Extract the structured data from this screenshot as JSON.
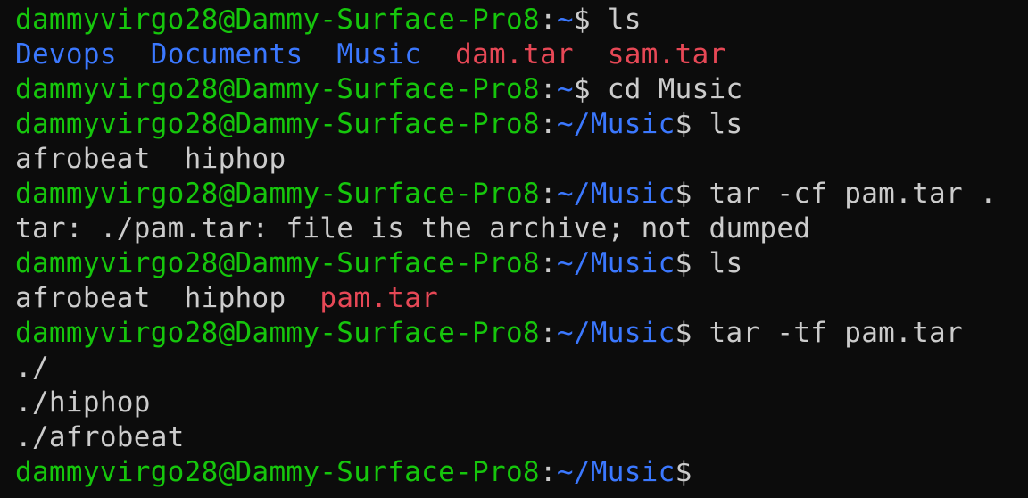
{
  "terminal": {
    "colors": {
      "background": "#0c0c0c",
      "foreground": "#cccccc",
      "prompt_user": "#16c60c",
      "prompt_path": "#3b78ff",
      "directory": "#3b78ff",
      "archive": "#e74856"
    },
    "prompt_user": "dammyvirgo28@Dammy-Surface-Pro8",
    "prompt_sep": ":",
    "lines": {
      "l1": {
        "path": "~",
        "dollar": "$",
        "cmd": " ls"
      },
      "l2": {
        "items": [
          "Devops",
          "Documents",
          "Music",
          "dam.tar",
          "sam.tar"
        ]
      },
      "l3": {
        "path": "~",
        "dollar": "$",
        "cmd": " cd Music"
      },
      "l4": {
        "path": "~/Music",
        "dollar": "$",
        "cmd": " ls"
      },
      "l5": {
        "items": [
          "afrobeat",
          "hiphop"
        ]
      },
      "l6": {
        "path": "~/Music",
        "dollar": "$",
        "cmd": " tar -cf pam.tar ."
      },
      "l7": {
        "text": "tar: ./pam.tar: file is the archive; not dumped"
      },
      "l8": {
        "path": "~/Music",
        "dollar": "$",
        "cmd": " ls"
      },
      "l9": {
        "items": [
          "afrobeat",
          "hiphop",
          "pam.tar"
        ]
      },
      "l10": {
        "path": "~/Music",
        "dollar": "$",
        "cmd": " tar -tf pam.tar"
      },
      "l11": {
        "text": "./"
      },
      "l12": {
        "text": "./hiphop"
      },
      "l13": {
        "text": "./afrobeat"
      },
      "l14": {
        "path": "~/Music",
        "dollar": "$"
      }
    }
  }
}
